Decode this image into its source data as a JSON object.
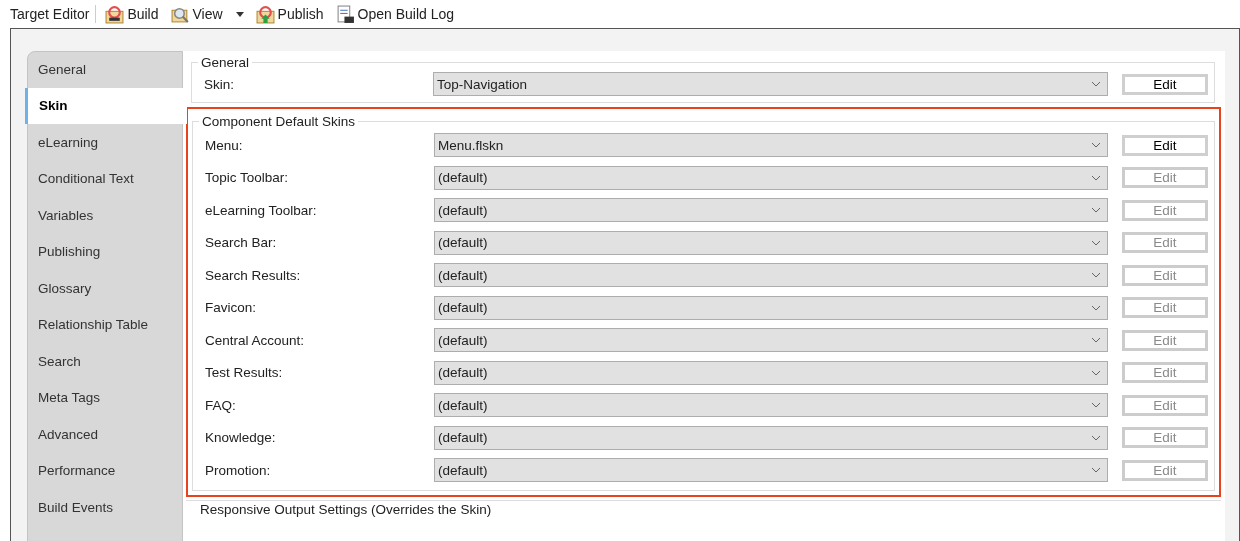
{
  "toolbar": {
    "title": "Target Editor",
    "items": [
      {
        "label": "Build",
        "dropdown": false
      },
      {
        "label": "View",
        "dropdown": true
      },
      {
        "label": "Publish",
        "dropdown": false
      },
      {
        "label": "Open Build Log",
        "dropdown": false
      }
    ]
  },
  "tabs": [
    {
      "label": "General",
      "selected": false
    },
    {
      "label": "Skin",
      "selected": true
    },
    {
      "label": "eLearning",
      "selected": false
    },
    {
      "label": "Conditional Text",
      "selected": false
    },
    {
      "label": "Variables",
      "selected": false
    },
    {
      "label": "Publishing",
      "selected": false
    },
    {
      "label": "Glossary",
      "selected": false
    },
    {
      "label": "Relationship Table",
      "selected": false
    },
    {
      "label": "Search",
      "selected": false
    },
    {
      "label": "Meta Tags",
      "selected": false
    },
    {
      "label": "Advanced",
      "selected": false
    },
    {
      "label": "Performance",
      "selected": false
    },
    {
      "label": "Build Events",
      "selected": false
    }
  ],
  "general_group": {
    "title": "General",
    "rows": [
      {
        "label": "Skin:",
        "value": "Top-Navigation",
        "button": "Edit",
        "button_disabled": false
      }
    ]
  },
  "component_group": {
    "title": "Component Default Skins",
    "highlighted": true,
    "rows": [
      {
        "label": "Menu:",
        "value": "Menu.flskn",
        "button": "Edit",
        "button_disabled": false
      },
      {
        "label": "Topic Toolbar:",
        "value": "(default)",
        "button": "Edit",
        "button_disabled": true
      },
      {
        "label": "eLearning Toolbar:",
        "value": "(default)",
        "button": "Edit",
        "button_disabled": true
      },
      {
        "label": "Search Bar:",
        "value": "(default)",
        "button": "Edit",
        "button_disabled": true
      },
      {
        "label": "Search Results:",
        "value": "(default)",
        "button": "Edit",
        "button_disabled": true
      },
      {
        "label": "Favicon:",
        "value": "(default)",
        "button": "Edit",
        "button_disabled": true
      },
      {
        "label": "Central Account:",
        "value": "(default)",
        "button": "Edit",
        "button_disabled": true
      },
      {
        "label": "Test Results:",
        "value": "(default)",
        "button": "Edit",
        "button_disabled": true
      },
      {
        "label": "FAQ:",
        "value": "(default)",
        "button": "Edit",
        "button_disabled": true
      },
      {
        "label": "Knowledge:",
        "value": "(default)",
        "button": "Edit",
        "button_disabled": true
      },
      {
        "label": "Promotion:",
        "value": "(default)",
        "button": "Edit",
        "button_disabled": true
      }
    ]
  },
  "responsive_group": {
    "title": "Responsive Output Settings (Overrides the Skin)"
  }
}
